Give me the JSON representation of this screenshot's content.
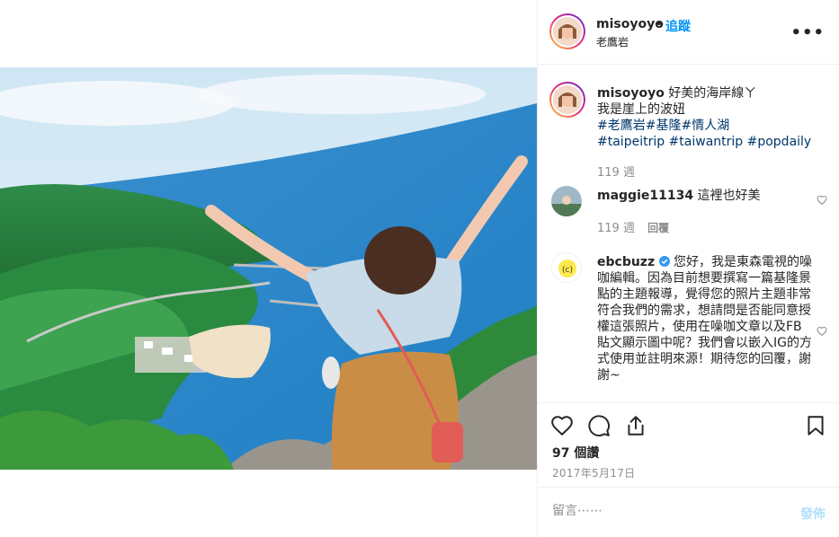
{
  "header": {
    "username": "misoyoyo",
    "dot": "•",
    "follow_label": "追蹤",
    "location": "老鷹岩",
    "more_label": "•••"
  },
  "caption": {
    "username": "misoyoyo",
    "line1": "好美的海岸線ㄚ",
    "line2": "我是崖上的波妞",
    "hashtags_line1": "#老鷹岩#基隆#情人湖",
    "hashtags_line2": "#taipeitrip #taiwantrip #popdaily",
    "age": "119 週"
  },
  "comments": [
    {
      "username": "maggie11134",
      "text": "這裡也好美",
      "age": "119 週",
      "reply_label": "回覆"
    },
    {
      "username": "ebcbuzz",
      "verified": true,
      "text": "您好，我是東森電視的噪咖編輯。因為目前想要撰寫一篇基隆景點的主題報導，覺得您的照片主題非常符合我們的需求，想請問是否能同意授權這張照片，使用在噪咖文章以及FB貼文顯示圖中呢？我們會以嵌入IG的方式使用並註明來源！期待您的回覆，謝謝~"
    }
  ],
  "actions": {
    "likes": "97 個讚",
    "date": "2017年5月17日"
  },
  "comment_box": {
    "placeholder": "留言⋯⋯",
    "post_label": "發佈"
  },
  "colors": {
    "accent": "#0095f6",
    "link": "#00376b",
    "muted": "#8e8e8e"
  }
}
